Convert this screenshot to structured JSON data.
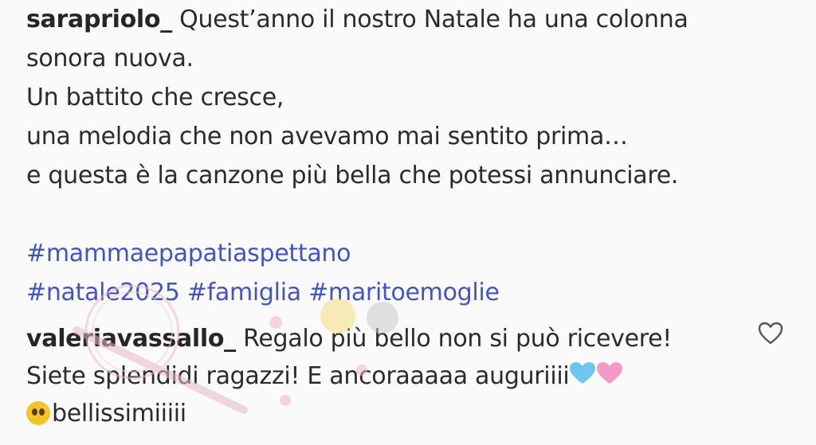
{
  "post": {
    "username": "sarapriolo_",
    "caption_lines": [
      "Quest’anno il nostro Natale ha una colonna",
      "sonora nuova.",
      "Un battito che cresce,",
      "una melodia che non avevamo mai sentito prima…",
      "e questa è la canzone più bella che potessi annunciare."
    ],
    "hashtags_line1": "#mammaepapatiaspettano",
    "hashtags_line2": [
      "#natale2025",
      "#famiglia",
      "#maritoemoglie"
    ]
  },
  "comment": {
    "username": "valeriavassallo_",
    "line1": "Regalo più bello non si può ricevere!",
    "line2_text": "Siete splendidi ragazzi! E ancoraaaaa auguriiii",
    "emoji_blue_heart": "🩵",
    "emoji_pink_heart": "🩷",
    "emoji_face": "pleading-face-icon",
    "line3_text": "bellissimiiiii",
    "like_icon": "heart-outline-icon"
  },
  "colors": {
    "text": "#2b2b2b",
    "hashtag": "#4355b9",
    "background": "#fafafa",
    "blue_heart": "#6ec6f0",
    "pink_heart": "#f59ac6"
  }
}
